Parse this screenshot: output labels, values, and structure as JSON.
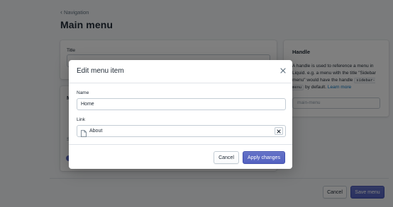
{
  "header": {
    "breadcrumb": "Navigation",
    "title": "Main menu"
  },
  "title_card": {
    "label": "Title"
  },
  "menu_items_card": {
    "title_fragment": "M",
    "stub_fragment": "S"
  },
  "handle_card": {
    "title": "Handle",
    "description_pre": "A handle is used to reference a menu in Liquid. e.g. a menu with the title \"Sidebar menu\" would have the handle ",
    "code": "sidebar-menu",
    "description_post": " by default. ",
    "learn_more": "Learn more",
    "input_value": "main-menu"
  },
  "page_actions": {
    "cancel": "Cancel",
    "save": "Save menu"
  },
  "modal": {
    "title": "Edit menu item",
    "name_label": "Name",
    "name_value": "Home",
    "link_label": "Link",
    "link_value": "About",
    "cancel": "Cancel",
    "apply": "Apply changes"
  },
  "colors": {
    "primary": "#5c6ac4",
    "link": "#006fbb",
    "backdrop": "rgba(0,0,0,0.5)"
  }
}
